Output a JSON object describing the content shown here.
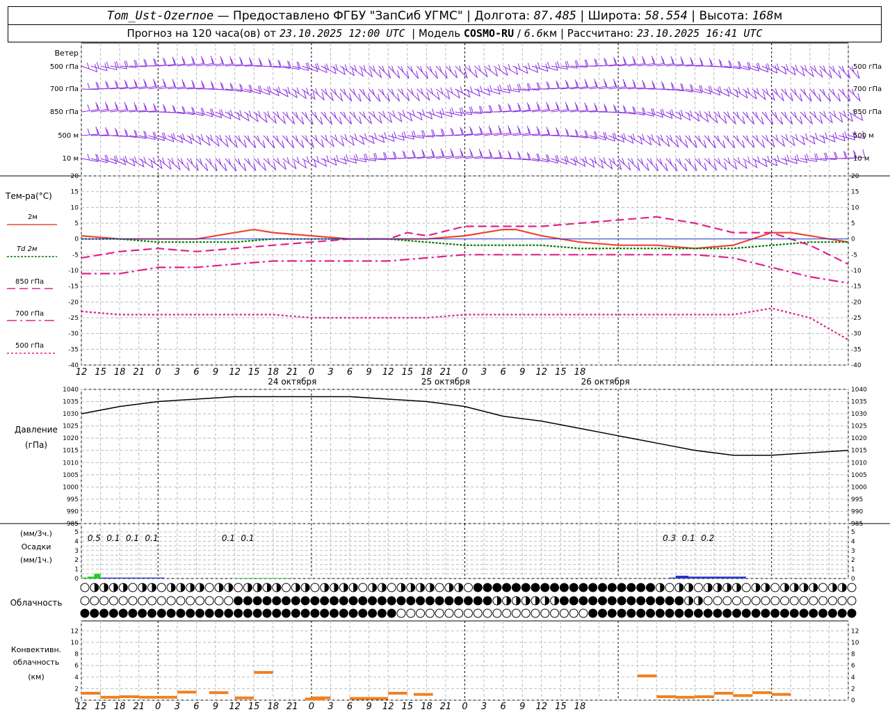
{
  "header": {
    "station": "Tom_Ust-Ozernoe",
    "provider": "— Предоставлено ФГБУ \"ЗапСиб УГМС\"",
    "lon_label": "Долгота:",
    "lon": "87.485",
    "lat_label": "Широта:",
    "lat": "58.554",
    "alt_label": "Высота:",
    "alt": "168",
    "alt_unit": "м",
    "forecast_label": "Прогноз на 120 часа(ов) от",
    "forecast_time": "23.10.2025 12:00 UTC",
    "model_label": "Модель",
    "model": "COSMO-RU",
    "model_res": "6.6",
    "model_res_unit": "км",
    "calc_label": "Рассчитано:",
    "calc_time": "23.10.2025 16:41 UTC"
  },
  "wind": {
    "title": "Ветер",
    "levels": [
      "500 гПа",
      "700 гПа",
      "850 гПа",
      "500 м",
      "10  м"
    ]
  },
  "temp": {
    "title": "Тем-ра(°C)",
    "legend": [
      "2м",
      "Td  2м",
      "850 гПа",
      "700 гПа",
      "500 гПа"
    ]
  },
  "pressure": {
    "title1": "Давление",
    "title2": "(гПа)"
  },
  "precip": {
    "unit3": "(мм/3ч.)",
    "title": "Осадки",
    "unit1": "(мм/1ч.)",
    "labels": [
      {
        "h": 2,
        "text": "0.5"
      },
      {
        "h": 5,
        "text": "0.1"
      },
      {
        "h": 8,
        "text": "0.1"
      },
      {
        "h": 11,
        "text": "0.1"
      },
      {
        "h": 23,
        "text": "0.1"
      },
      {
        "h": 26,
        "text": "0.1"
      },
      {
        "h": 92,
        "text": "0.3"
      },
      {
        "h": 95,
        "text": "0.1"
      },
      {
        "h": 98,
        "text": "0.2"
      }
    ]
  },
  "cloud": {
    "title": "Облачность"
  },
  "conv": {
    "title1": "Конвективн.",
    "title2": "облачность",
    "title3": "(км)"
  },
  "time_axis": {
    "ticks": [
      "12",
      "15",
      "18",
      "21",
      "0",
      "3",
      "6",
      "9",
      "12",
      "15",
      "18",
      "21",
      "0",
      "3",
      "6",
      "9",
      "12",
      "15",
      "18",
      "21",
      "0",
      "3",
      "6",
      "9",
      "12",
      "15",
      "18"
    ],
    "dates": [
      {
        "h": 33,
        "text": "24 октября"
      },
      {
        "h": 57,
        "text": "25 октября"
      },
      {
        "h": 82,
        "text": "26 октября"
      }
    ]
  },
  "colors": {
    "wind": "#8a2be2",
    "t2m": "#ee4433",
    "td": "#007700",
    "p850": "#e0208a",
    "precip_green": "#22cc22",
    "precip_blue": "#2233cc",
    "conv": "#f08020"
  },
  "chart_data": [
    {
      "type": "line",
      "title": "Тем-ра(°C)",
      "x_unit": "hours from 23.10.2025 12:00 UTC",
      "ylim": [
        -40,
        20
      ],
      "series": [
        {
          "name": "2м",
          "x": [
            0,
            6,
            12,
            18,
            24,
            27,
            30,
            36,
            42,
            48,
            54,
            60,
            66,
            68,
            72,
            78,
            84,
            90,
            96,
            102,
            108,
            111,
            114,
            120
          ],
          "values": [
            1,
            0,
            0,
            0,
            2,
            3,
            2,
            1,
            0,
            0,
            0,
            1,
            3,
            3,
            1,
            -1,
            -2,
            -2,
            -3,
            -2,
            2,
            2,
            1,
            -1
          ]
        },
        {
          "name": "Td  2м",
          "x": [
            0,
            6,
            12,
            18,
            24,
            30,
            36,
            42,
            48,
            54,
            60,
            66,
            72,
            78,
            84,
            90,
            96,
            102,
            108,
            114,
            120
          ],
          "values": [
            0,
            0,
            -1,
            -1,
            -1,
            0,
            0,
            0,
            0,
            -1,
            -2,
            -2,
            -2,
            -3,
            -3,
            -3,
            -3,
            -3,
            -2,
            -1,
            -1
          ]
        },
        {
          "name": "850 гПа",
          "x": [
            0,
            6,
            12,
            18,
            24,
            30,
            36,
            42,
            48,
            51,
            54,
            60,
            66,
            72,
            78,
            84,
            90,
            96,
            102,
            108,
            114,
            120
          ],
          "values": [
            -6,
            -4,
            -3,
            -4,
            -3,
            -2,
            -1,
            0,
            0,
            2,
            1,
            4,
            4,
            4,
            5,
            6,
            7,
            5,
            2,
            2,
            -2,
            -8
          ]
        },
        {
          "name": "700 гПа",
          "x": [
            0,
            6,
            12,
            18,
            24,
            30,
            36,
            42,
            48,
            54,
            60,
            66,
            72,
            78,
            84,
            90,
            96,
            102,
            108,
            114,
            120
          ],
          "values": [
            -11,
            -11,
            -9,
            -9,
            -8,
            -7,
            -7,
            -7,
            -7,
            -6,
            -5,
            -5,
            -5,
            -5,
            -5,
            -5,
            -5,
            -6,
            -9,
            -12,
            -14
          ]
        },
        {
          "name": "500 гПа",
          "x": [
            0,
            6,
            12,
            18,
            24,
            30,
            36,
            42,
            48,
            54,
            60,
            66,
            72,
            78,
            84,
            90,
            96,
            102,
            108,
            114,
            120
          ],
          "values": [
            -23,
            -24,
            -24,
            -24,
            -24,
            -24,
            -25,
            -25,
            -25,
            -25,
            -24,
            -24,
            -24,
            -24,
            -24,
            -24,
            -24,
            -24,
            -22,
            -25,
            -32
          ]
        }
      ]
    },
    {
      "type": "line",
      "title": "Давление",
      "ylabel": "(гПа)",
      "ylim": [
        985,
        1040
      ],
      "series": [
        {
          "name": "Давление",
          "x": [
            0,
            6,
            12,
            18,
            24,
            30,
            36,
            42,
            48,
            54,
            60,
            66,
            72,
            78,
            84,
            90,
            96,
            102,
            108,
            114,
            120
          ],
          "values": [
            1030,
            1033,
            1035,
            1036,
            1037,
            1037,
            1037,
            1037,
            1036,
            1035,
            1033,
            1029,
            1027,
            1024,
            1021,
            1018,
            1015,
            1013,
            1013,
            1014,
            1015
          ]
        }
      ]
    },
    {
      "type": "bar",
      "title": "Осадки",
      "ylim": [
        0,
        5
      ],
      "series": [
        {
          "name": "(мм/1ч.)",
          "x": [
            0,
            1,
            2,
            3,
            4,
            5,
            6,
            7,
            8,
            9,
            10,
            11,
            12,
            24,
            25,
            26,
            27,
            28,
            29,
            30,
            31,
            32,
            92,
            93,
            94,
            95,
            96,
            97,
            98,
            99,
            100,
            101,
            102,
            103
          ],
          "values": [
            0.1,
            0.2,
            0.5,
            0.1,
            0.1,
            0.1,
            0.1,
            0.1,
            0.1,
            0.1,
            0.1,
            0.1,
            0.1,
            0.05,
            0.05,
            0.05,
            0.05,
            0.05,
            0.05,
            0.05,
            0.05,
            0.05,
            0.1,
            0.3,
            0.3,
            0.2,
            0.2,
            0.2,
            0.2,
            0.2,
            0.2,
            0.2,
            0.2,
            0.2
          ]
        }
      ]
    },
    {
      "type": "bar",
      "title": "Конвективн. облачность",
      "ylim": [
        0,
        13
      ],
      "series": [
        {
          "name": "(км)",
          "x": [
            0,
            3,
            6,
            9,
            12,
            15,
            20,
            24,
            27,
            35,
            36,
            42,
            45,
            48,
            52,
            87,
            90,
            93,
            96,
            99,
            102,
            105,
            108
          ],
          "values": [
            1.2,
            0.5,
            0.6,
            0.5,
            0.5,
            1.4,
            1.3,
            0.4,
            4.8,
            0.2,
            0.4,
            0.3,
            0.3,
            1.2,
            1.0,
            4.2,
            0.6,
            0.5,
            0.6,
            1.2,
            0.8,
            1.3,
            1.0
          ]
        }
      ]
    }
  ]
}
